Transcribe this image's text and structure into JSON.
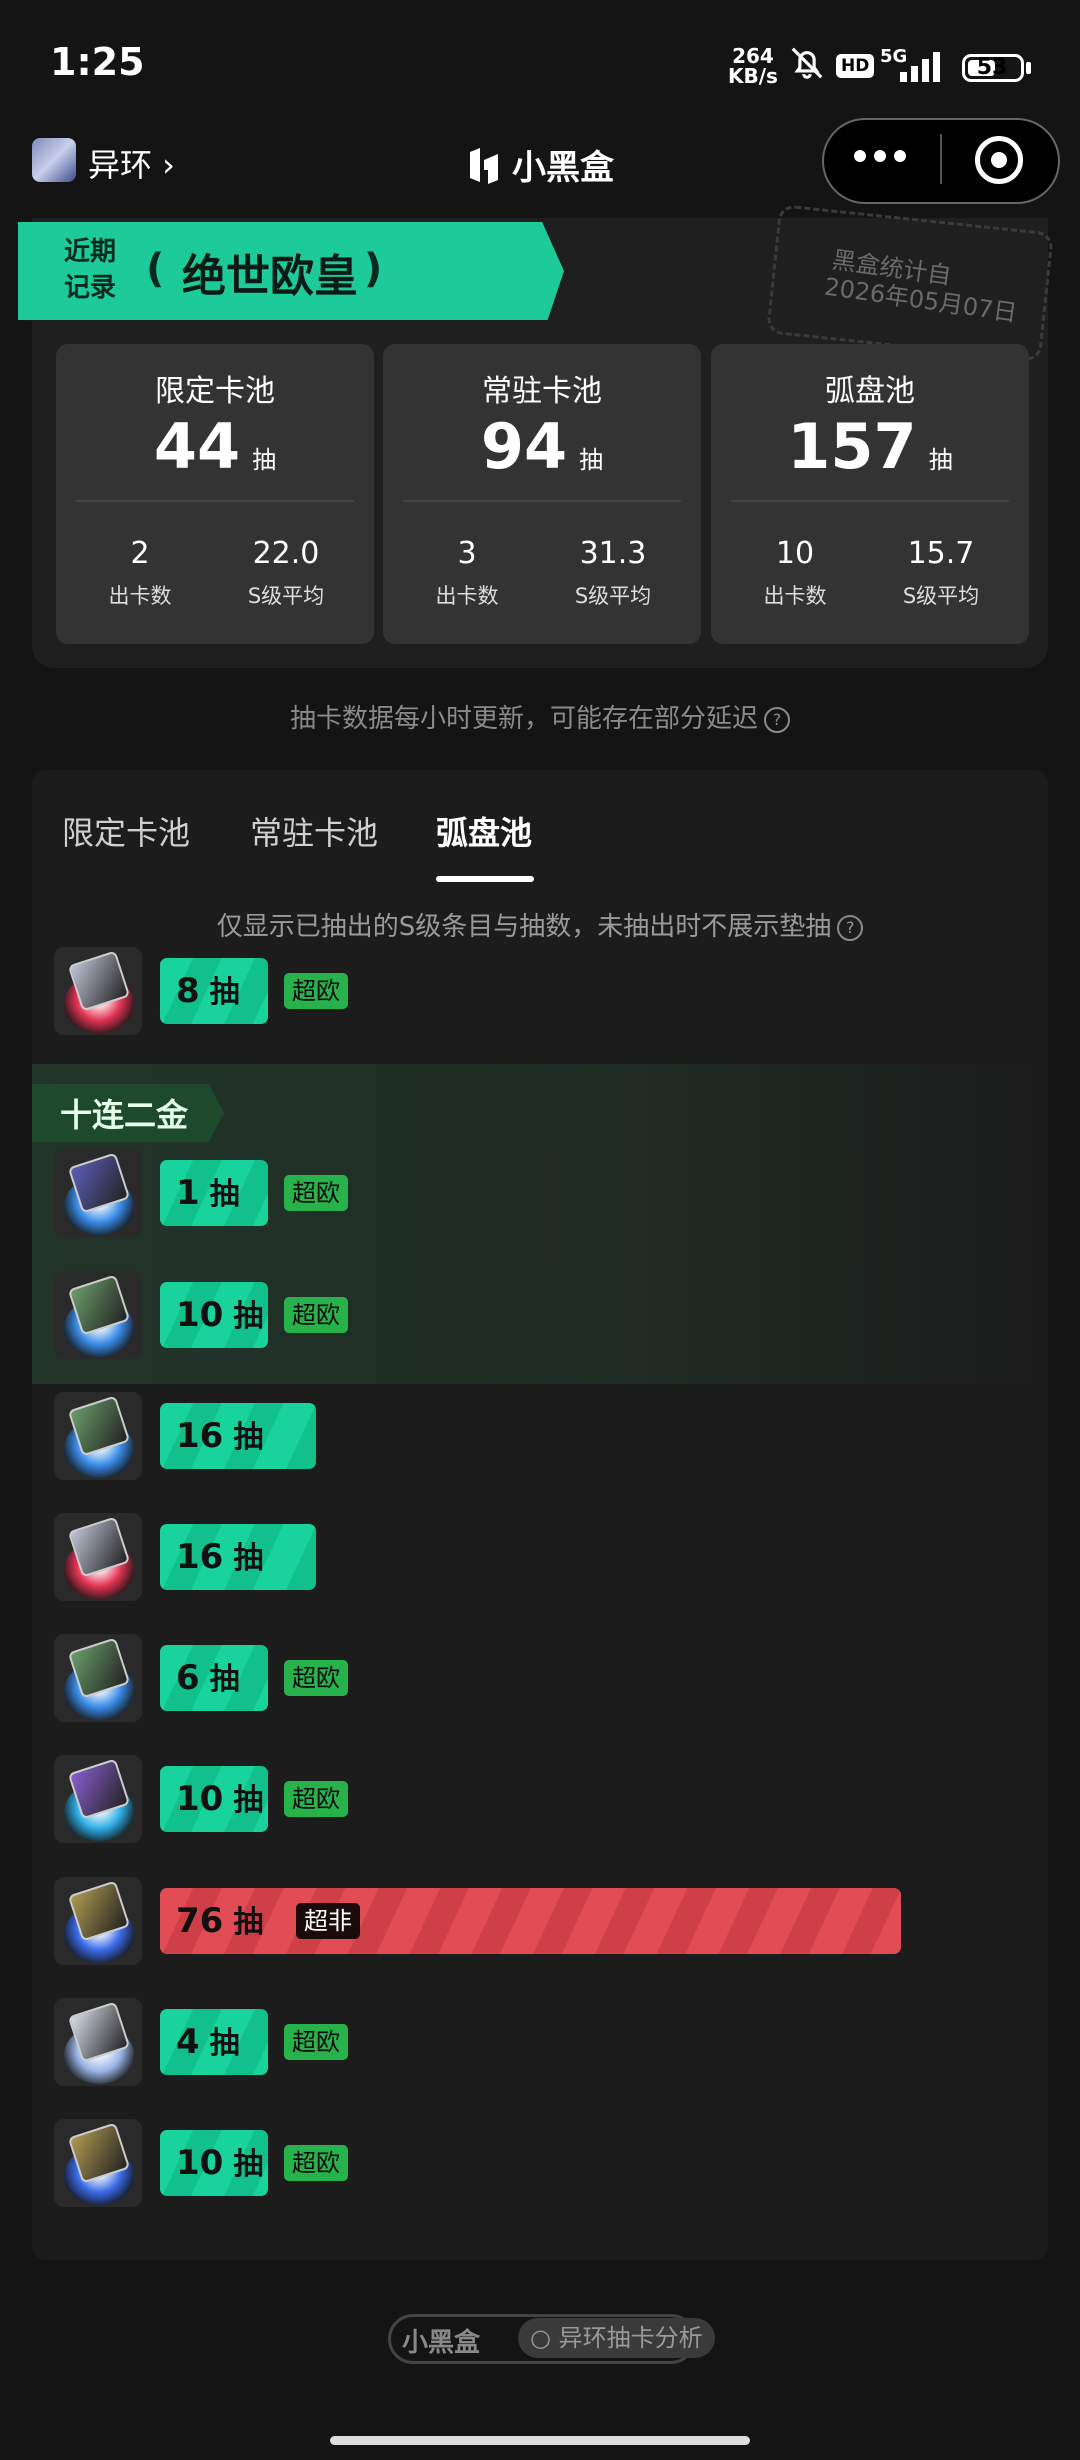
{
  "status_bar": {
    "time": "1:25",
    "net_speed": "264",
    "net_unit": "KB/s",
    "hd": "HD",
    "network": "5G",
    "battery": "53",
    "battery_level_percent": 53
  },
  "header": {
    "game_name": "异环 ›",
    "brand": "小黑盒"
  },
  "record": {
    "badge_line1": "近期",
    "badge_line2": "记录",
    "title": "绝世欧皇",
    "stamp_line1": "黑盒统计自",
    "stamp_line2": "2026年05月07日",
    "pools": [
      {
        "name": "限定卡池",
        "count": "44",
        "unit": "抽",
        "stat1_value": "2",
        "stat1_label": "出卡数",
        "stat2_value": "22.0",
        "stat2_label": "S级平均"
      },
      {
        "name": "常驻卡池",
        "count": "94",
        "unit": "抽",
        "stat1_value": "3",
        "stat1_label": "出卡数",
        "stat2_value": "31.3",
        "stat2_label": "S级平均"
      },
      {
        "name": "弧盘池",
        "count": "157",
        "unit": "抽",
        "stat1_value": "10",
        "stat1_label": "出卡数",
        "stat2_value": "15.7",
        "stat2_label": "S级平均"
      }
    ]
  },
  "update_note": "抽卡数据每小时更新，可能存在部分延迟",
  "tabs": {
    "limited": "限定卡池",
    "standard": "常驻卡池",
    "disc": "弧盘池",
    "active": "弧盘池"
  },
  "list_note": "仅显示已抽出的S级条目与抽数，未抽出时不展示垫抽",
  "ten_pull_label": "十连二金",
  "pull_unit": "抽",
  "max_pulls": 80,
  "entries": [
    {
      "pulls": "8",
      "tag": "超欧",
      "bad": false
    },
    {
      "pulls": "1",
      "tag": "超欧",
      "bad": false
    },
    {
      "pulls": "10",
      "tag": "超欧",
      "bad": false
    },
    {
      "pulls": "16",
      "tag": "",
      "bad": false
    },
    {
      "pulls": "16",
      "tag": "",
      "bad": false
    },
    {
      "pulls": "6",
      "tag": "超欧",
      "bad": false
    },
    {
      "pulls": "10",
      "tag": "超欧",
      "bad": false
    },
    {
      "pulls": "76",
      "tag": "超非",
      "bad": true
    },
    {
      "pulls": "4",
      "tag": "超欧",
      "bad": false
    },
    {
      "pulls": "10",
      "tag": "超欧",
      "bad": false
    }
  ],
  "footer": {
    "brand": "小黑盒",
    "label": "异环抽卡分析"
  }
}
